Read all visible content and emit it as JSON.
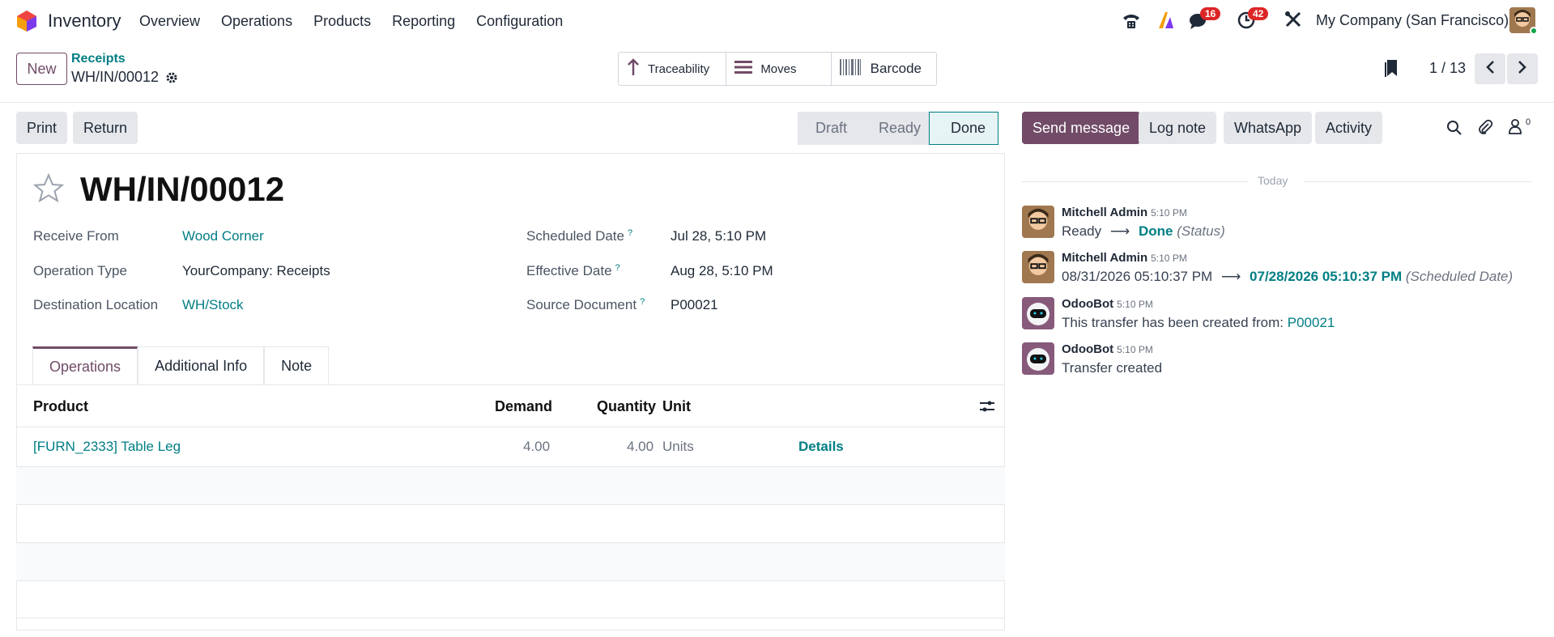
{
  "app": {
    "name": "Inventory",
    "menu": [
      "Overview",
      "Operations",
      "Products",
      "Reporting",
      "Configuration"
    ],
    "company": "My Company (San Francisco)",
    "badges": {
      "messages": "16",
      "activities": "42"
    }
  },
  "control": {
    "new_label": "New",
    "breadcrumb_parent": "Receipts",
    "breadcrumb_current": "WH/IN/00012",
    "smart_buttons": [
      "Traceability",
      "Moves",
      "Barcode"
    ],
    "pager": "1 / 13"
  },
  "actions": {
    "print": "Print",
    "return": "Return"
  },
  "statusbar": {
    "steps": [
      "Draft",
      "Ready",
      "Done"
    ],
    "active": "Done"
  },
  "record": {
    "title": "WH/IN/00012",
    "fields_left": [
      {
        "label": "Receive From",
        "value": "Wood Corner",
        "link": true
      },
      {
        "label": "Operation Type",
        "value": "YourCompany: Receipts",
        "link": false
      },
      {
        "label": "Destination Location",
        "value": "WH/Stock",
        "link": true
      }
    ],
    "fields_right": [
      {
        "label": "Scheduled Date",
        "value": "Jul 28, 5:10 PM"
      },
      {
        "label": "Effective Date",
        "value": "Aug 28, 5:10 PM"
      },
      {
        "label": "Source Document",
        "value": "P00021"
      }
    ],
    "tooltip_mark": "?"
  },
  "tabs": [
    "Operations",
    "Additional Info",
    "Note"
  ],
  "table": {
    "headers": {
      "product": "Product",
      "demand": "Demand",
      "quantity": "Quantity",
      "unit": "Unit"
    },
    "rows": [
      {
        "product": "[FURN_2333] Table Leg",
        "demand": "4.00",
        "quantity": "4.00",
        "unit": "Units",
        "details": "Details"
      }
    ]
  },
  "chatter": {
    "buttons": [
      "Send message",
      "Log note",
      "WhatsApp",
      "Activity"
    ],
    "followers": "0",
    "today": "Today",
    "messages": [
      {
        "author": "Mitchell Admin",
        "time": "5:10 PM",
        "from": "Ready",
        "to": "Done",
        "field": "(Status)"
      },
      {
        "author": "Mitchell Admin",
        "time": "5:10 PM",
        "from": "08/31/2026 05:10:37 PM",
        "to": "07/28/2026 05:10:37 PM",
        "field": "(Scheduled Date)"
      },
      {
        "author": "OdooBot",
        "time": "5:10 PM",
        "text": "This transfer has been created from:",
        "link": "P00021"
      },
      {
        "author": "OdooBot",
        "time": "5:10 PM",
        "text": "Transfer created"
      }
    ]
  },
  "colors": {
    "primary": "#714b67",
    "link": "#017e84",
    "badge": "#dc2626"
  }
}
